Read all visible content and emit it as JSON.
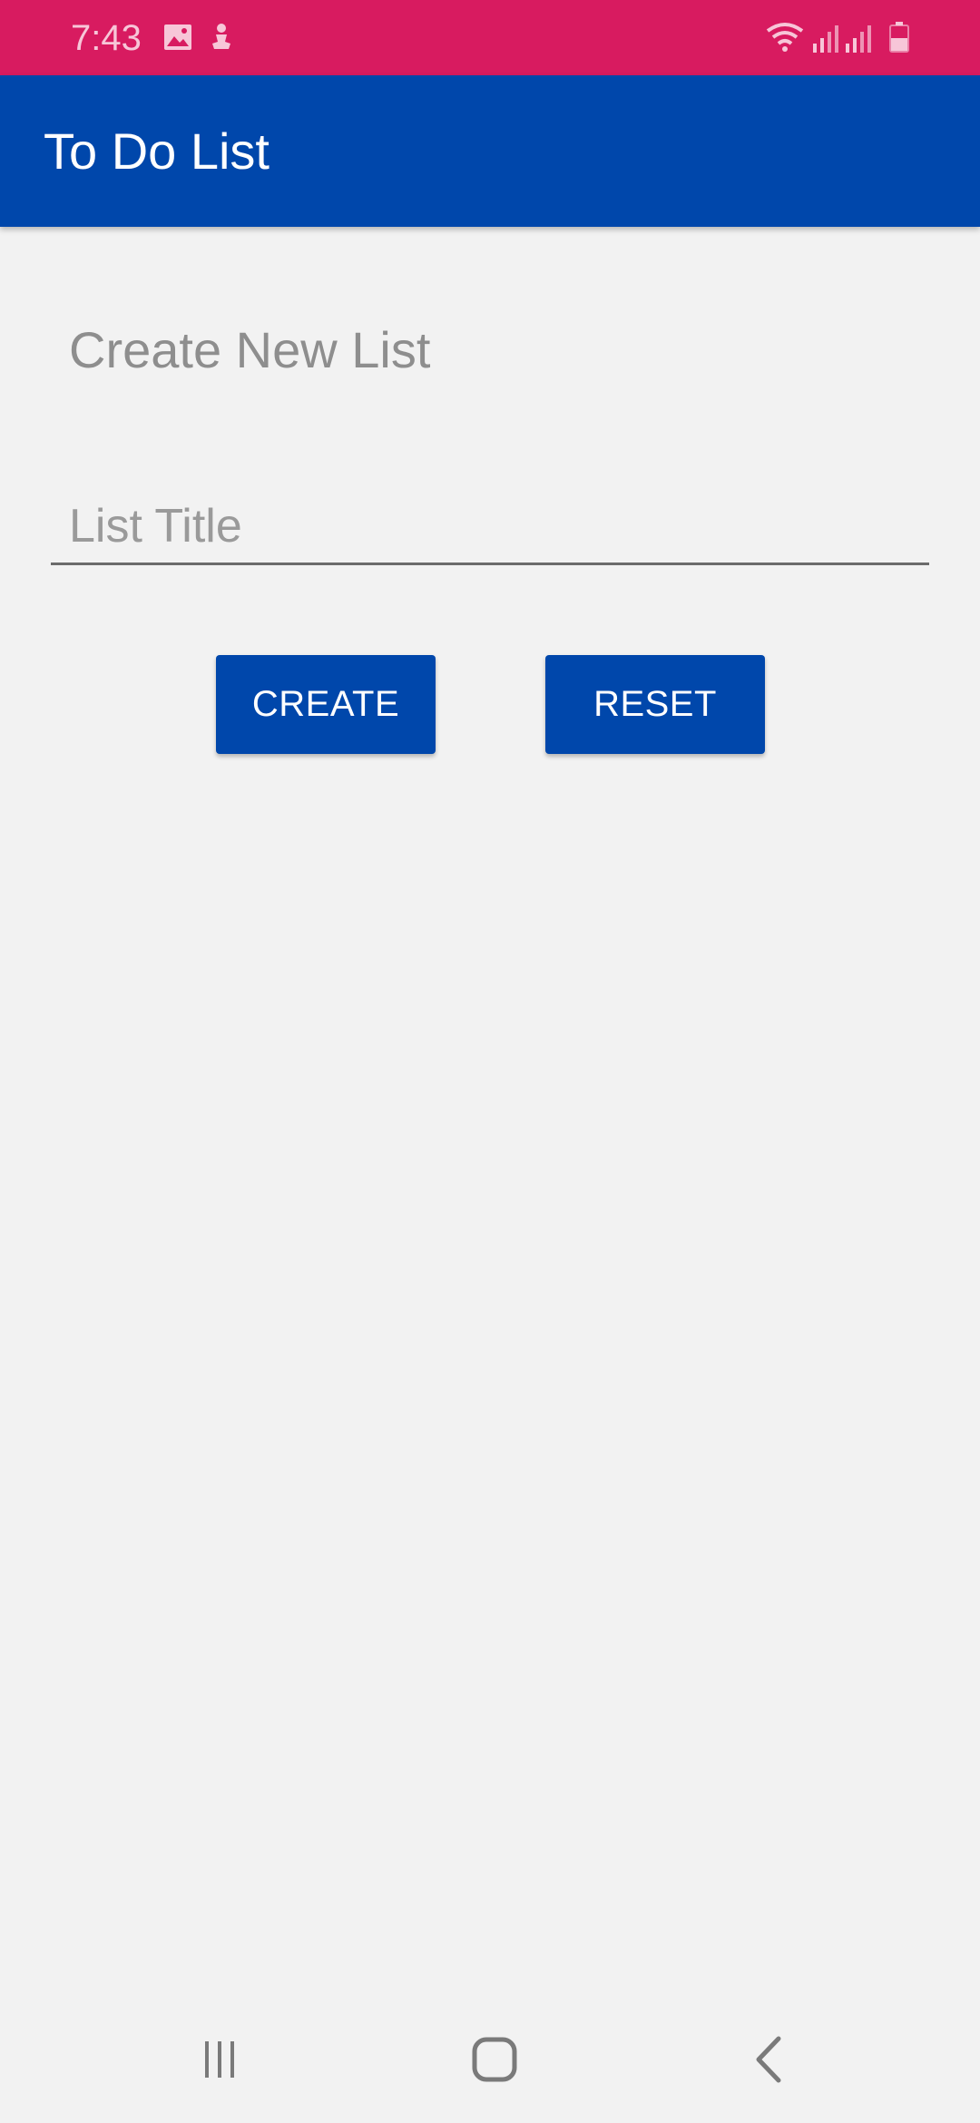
{
  "status_bar": {
    "time": "7:43",
    "bg_color": "#d81b60",
    "icons": [
      "image-icon",
      "app-notification-icon",
      "wifi-icon",
      "signal-icon",
      "signal-icon-2",
      "battery-icon"
    ]
  },
  "app_bar": {
    "title": "To Do List",
    "bg_color": "#0047ab"
  },
  "main": {
    "heading": "Create New List",
    "title_input": {
      "placeholder": "List Title",
      "value": ""
    },
    "buttons": {
      "create_label": "CREATE",
      "reset_label": "RESET"
    }
  },
  "nav_bar": {
    "icons": [
      "recent-apps-icon",
      "home-icon",
      "back-icon"
    ]
  }
}
